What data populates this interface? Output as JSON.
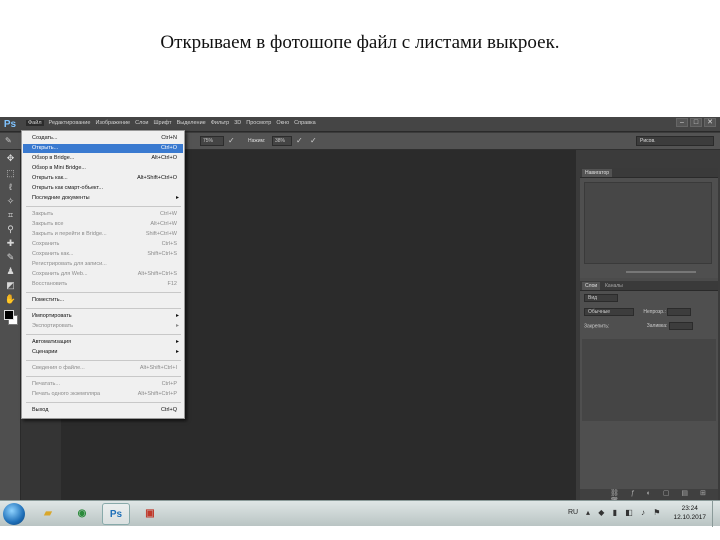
{
  "slide": {
    "title": "Открываем в фотошопе файл с листами выкроек."
  },
  "app": {
    "logo": "Ps",
    "menu": [
      "Файл",
      "Редактирование",
      "Изображение",
      "Слои",
      "Шрифт",
      "Выделение",
      "Фильтр",
      "3D",
      "Просмотр",
      "Окно",
      "Справка"
    ],
    "window_controls": [
      "–",
      "□",
      "✕"
    ]
  },
  "options_bar": {
    "opacity_value": "75%",
    "flow_label": "Нажим:",
    "flow_value": "38%",
    "workspace": "Рисов."
  },
  "file_menu": {
    "items": [
      {
        "label": "Создать...",
        "shortcut": "Ctrl+N",
        "state": "normal"
      },
      {
        "label": "Открыть...",
        "shortcut": "Ctrl+O",
        "state": "highlighted"
      },
      {
        "label": "Обзор в Bridge...",
        "shortcut": "Alt+Ctrl+O",
        "state": "normal"
      },
      {
        "label": "Обзор в Mini Bridge...",
        "shortcut": "",
        "state": "normal"
      },
      {
        "label": "Открыть как...",
        "shortcut": "Alt+Shift+Ctrl+O",
        "state": "normal"
      },
      {
        "label": "Открыть как смарт-объект...",
        "shortcut": "",
        "state": "normal"
      },
      {
        "label": "Последние документы",
        "shortcut": "",
        "state": "submenu"
      },
      {
        "label": "Закрыть",
        "shortcut": "Ctrl+W",
        "state": "disabled"
      },
      {
        "label": "Закрыть все",
        "shortcut": "Alt+Ctrl+W",
        "state": "disabled"
      },
      {
        "label": "Закрыть и перейти в Bridge...",
        "shortcut": "Shift+Ctrl+W",
        "state": "disabled"
      },
      {
        "label": "Сохранить",
        "shortcut": "Ctrl+S",
        "state": "disabled"
      },
      {
        "label": "Сохранить как...",
        "shortcut": "Shift+Ctrl+S",
        "state": "disabled"
      },
      {
        "label": "Регистрировать для записи...",
        "shortcut": "",
        "state": "disabled"
      },
      {
        "label": "Сохранить для Web...",
        "shortcut": "Alt+Shift+Ctrl+S",
        "state": "disabled"
      },
      {
        "label": "Восстановить",
        "shortcut": "F12",
        "state": "disabled"
      },
      {
        "label": "Поместить...",
        "shortcut": "",
        "state": "normal"
      },
      {
        "label": "Импортировать",
        "shortcut": "",
        "state": "submenu"
      },
      {
        "label": "Экспортировать",
        "shortcut": "",
        "state": "disabled-submenu"
      },
      {
        "label": "Автоматизация",
        "shortcut": "",
        "state": "submenu"
      },
      {
        "label": "Сценарии",
        "shortcut": "",
        "state": "submenu"
      },
      {
        "label": "Сведения о файле...",
        "shortcut": "Alt+Shift+Ctrl+I",
        "state": "disabled"
      },
      {
        "label": "Печатать...",
        "shortcut": "Ctrl+P",
        "state": "disabled"
      },
      {
        "label": "Печать одного экземпляра",
        "shortcut": "Alt+Shift+Ctrl+P",
        "state": "disabled"
      },
      {
        "label": "Выход",
        "shortcut": "Ctrl+Q",
        "state": "normal"
      }
    ]
  },
  "panels": {
    "navigator_tab": "Навигатор",
    "layers_tab": "Слои",
    "layers_tab2": "Каналы",
    "kind_label": "Вид",
    "blend_mode": "Обычные",
    "opacity_label": "Непрозр.:",
    "lock_label": "Закрепить:",
    "fill_label": "Заливка:"
  },
  "taskbar": {
    "lang": "RU",
    "time": "23:24",
    "date": "12.10.2017",
    "apps": [
      "folder",
      "chrome",
      "Ps",
      "ppt"
    ]
  },
  "colors": {
    "accent": "#3a7ad0",
    "ps_bg": "#2b2b2b",
    "menu_bg": "#f0f0f0"
  }
}
